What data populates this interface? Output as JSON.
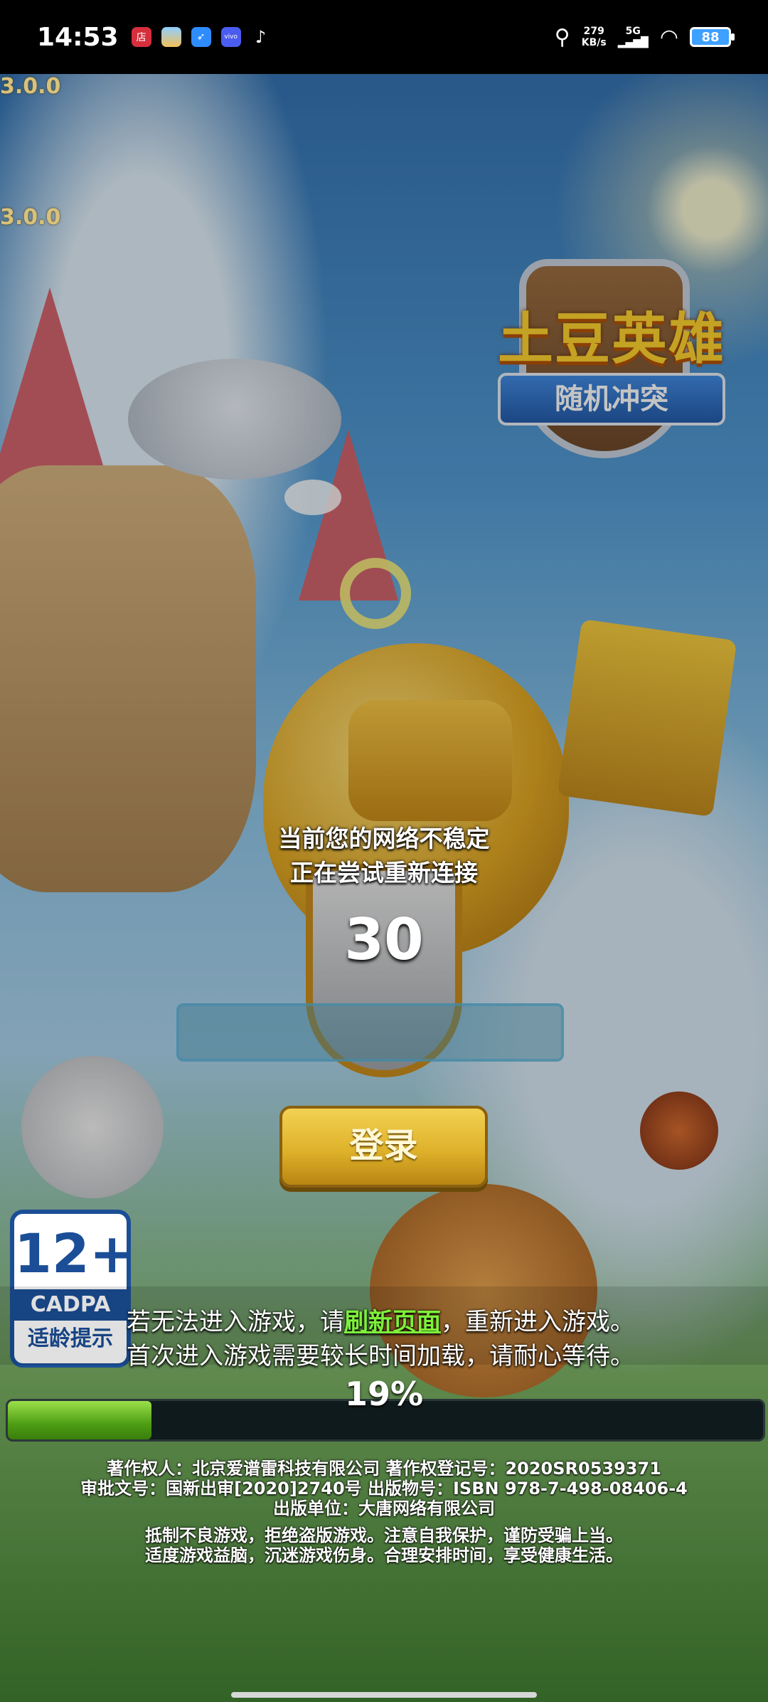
{
  "status_bar": {
    "time": "14:53",
    "network_speed": "279",
    "network_unit": "KB/s",
    "signal_type": "5G",
    "battery": "88",
    "app_icons": [
      "store-icon",
      "assistant-icon",
      "feather-app-icon",
      "vivo-icon",
      "tiktok-icon"
    ],
    "shop_icon_text": "店",
    "vivo_icon_text": "vivo"
  },
  "game": {
    "version_1": "3.0.0",
    "version_2": "3.0.0",
    "logo": {
      "title": "土豆英雄",
      "subtitle": "随机冲突"
    },
    "network_message_line1": "当前您的网络不稳定",
    "network_message_line2": "正在尝试重新连接",
    "countdown": "30",
    "input_value": "",
    "login_label": "登录",
    "age_rating": {
      "number": "12+",
      "brand": "CADPA",
      "label": "适龄提示"
    },
    "hint_line1_prefix": "若无法进入游戏，请",
    "hint_refresh_link": "刷新页面",
    "hint_line1_suffix": "，重新进入游戏。",
    "hint_line2": "首次进入游戏需要较长时间加载，请耐心等待。",
    "progress_percent_text": "19%",
    "progress_value": 0.19,
    "legal": {
      "line1": "著作权人：北京爱谱雷科技有限公司  著作权登记号：2020SR0539371",
      "line2": "审批文号：国新出审[2020]2740号  出版物号：ISBN 978-7-498-08406-4",
      "line3": "出版单位：大唐网络有限公司",
      "line4": "抵制不良游戏，拒绝盗版游戏。注意自我保护，谨防受骗上当。",
      "line5": "适度游戏益脑，沉迷游戏伤身。合理安排时间，享受健康生活。"
    }
  },
  "colors": {
    "link_green": "#7ef03a",
    "progress_green": "#4e9e14",
    "button_gold": "#dfb22b",
    "rating_blue": "#1b4e96"
  }
}
